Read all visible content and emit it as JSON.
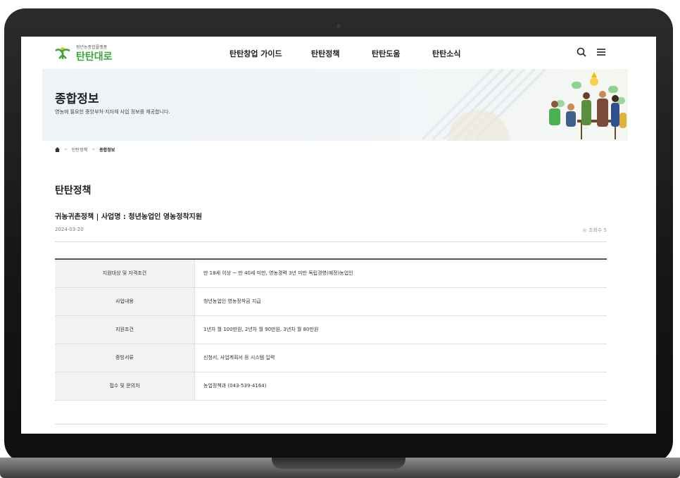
{
  "header": {
    "logo_sub": "청년농종합플랫폼",
    "logo_main": "탄탄대로",
    "nav": [
      "탄탄창업 가이드",
      "탄탄정책",
      "탄탄도움",
      "탄탄소식"
    ]
  },
  "banner": {
    "title": "종합정보",
    "description": "영농에 필요한 중앙부처·지자체 사업 정보를 제공합니다."
  },
  "breadcrumb": [
    "탄탄정책",
    "종합정보"
  ],
  "section_title": "탄탄정책",
  "post": {
    "title": "귀농귀촌정책 | 사업명 : 청년농업인 영농정착지원",
    "date": "2024-03-20",
    "views_label": "조회수 5"
  },
  "table": {
    "rows": [
      {
        "label": "지원대상 및 자격조건",
        "value": "만 18세 이상 ~ 만 40세 미만, 영농경력 3년 미만 독립경영(예정)농업인"
      },
      {
        "label": "사업내용",
        "value": "청년농업인 영농정착금 지급"
      },
      {
        "label": "지원조건",
        "value": "1년차 월 100만원, 2년차 월 90만원, 3년차 월 80만원"
      },
      {
        "label": "증빙서류",
        "value": "신청서, 사업계획서 등 시스템 입력"
      },
      {
        "label": "접수 및 문의처",
        "value": "농업정책과 (043-539-4164)"
      }
    ]
  },
  "colors": {
    "brand_green": "#3aa63a",
    "frame": "#151515"
  }
}
